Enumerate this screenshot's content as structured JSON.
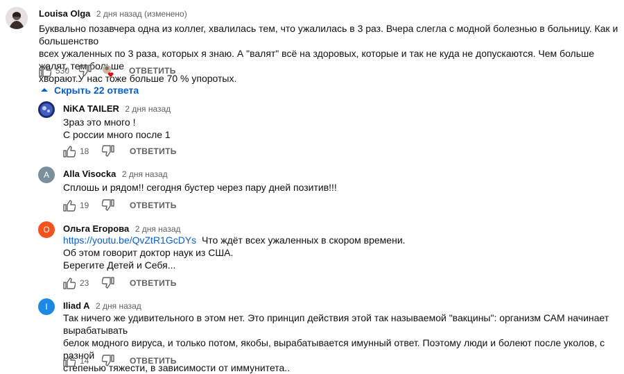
{
  "main": {
    "author": "Louisa Olga",
    "date": "2 дня назад (изменено)",
    "lines": [
      "Буквально позавчера одна из коллег, хвалилась тем, что ужалилась в 3 раз. Вчера слегла с модной болезнью в больницу. Как и большенство",
      "всех ужаленных по 3 раза, которых я знаю. А \"валят\" всё на здоровых, которые и так не куда не допускаются. Чем больше жалят, тем больше",
      "хворают.У нас тоже больше 70 % упоротых."
    ],
    "likes": "530",
    "reply_label": "ОТВЕТИТЬ"
  },
  "hide_replies_label": "Скрыть 22 ответа",
  "replies": [
    {
      "author": "NiKA TAILER",
      "date": "2 дня назад",
      "lines": [
        "Зраз  это много !",
        "С россии много после 1"
      ],
      "likes": "18",
      "reply_label": "ОТВЕТИТЬ"
    },
    {
      "author": "Alla Visocka",
      "date": "2 дня назад",
      "avatar_letter": "A",
      "avatar_color": "#78909c",
      "lines": [
        "Сплошь и рядом!! сегодня бустер через пару дней позитив!!!"
      ],
      "likes": "19",
      "reply_label": "ОТВЕТИТЬ"
    },
    {
      "author": "Ольга Егорова",
      "date": "2 дня назад",
      "avatar_letter": "О",
      "avatar_color": "#f4511e",
      "link": "https://youtu.be/QvZtR1GcDYs",
      "link_after": "  Что ждёт всех ужаленных в скором времени.",
      "lines": [
        "Об этом говорит доктор наук из США.",
        "Берегите Детей и Себя..."
      ],
      "likes": "23",
      "reply_label": "ОТВЕТИТЬ"
    },
    {
      "author": "Iliad A",
      "date": "2 дня назад",
      "avatar_letter": "I",
      "avatar_color": "#1e88e5",
      "lines": [
        "Так ничего же удивительного в этом нет. Это принцип действия этой так называемой \"вакцины\": организм САМ начинает вырабатывать",
        "белок модного вируса, и только потом, якобы, вырабатывается имунный ответ. Поэтому люди и болеют после уколов, с разной",
        "степенью тяжести, в зависимости от иммунитета.."
      ],
      "likes": "14",
      "reply_label": "ОТВЕТИТЬ"
    }
  ]
}
